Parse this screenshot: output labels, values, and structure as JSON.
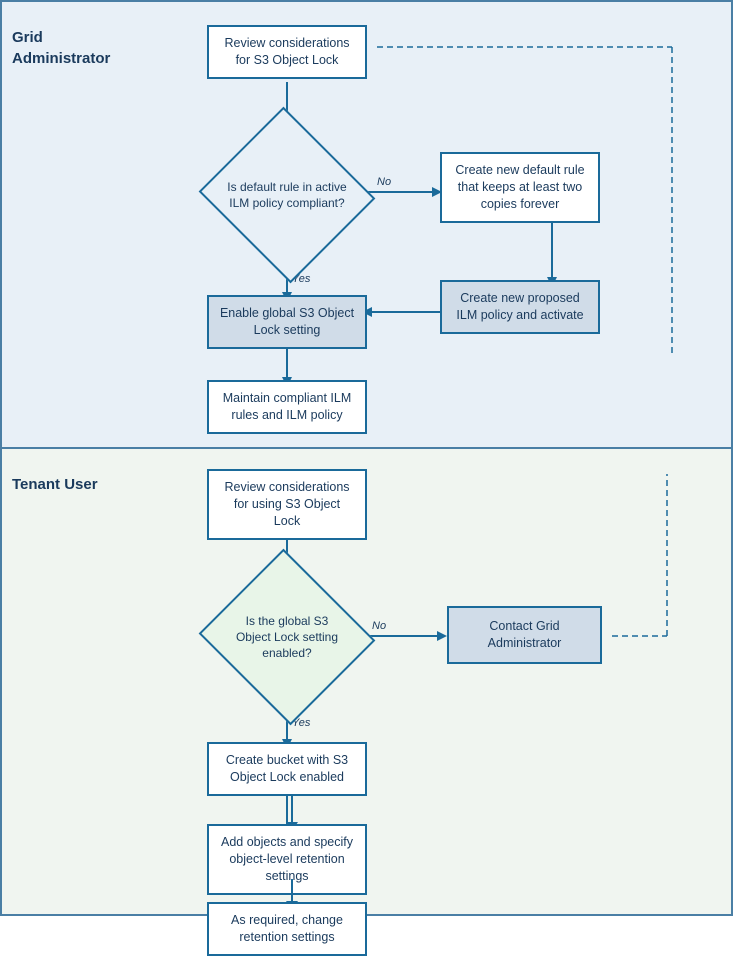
{
  "sections": {
    "top": {
      "label": "Grid\nAdministrator",
      "boxes": {
        "review": "Review considerations for S3 Object Lock",
        "diamond_question": "Is default rule in active ILM policy compliant?",
        "diamond_no_label": "No",
        "diamond_yes_label": "Yes",
        "enable_global": "Enable global S3 Object Lock setting",
        "maintain": "Maintain compliant ILM rules and ILM policy",
        "new_default_rule": "Create new default rule that keeps at least two copies forever",
        "new_proposed_policy": "Create new proposed ILM policy and activate"
      }
    },
    "bottom": {
      "label": "Tenant User",
      "boxes": {
        "review": "Review considerations for using S3 Object Lock",
        "diamond_question": "Is the global S3 Object Lock setting enabled?",
        "diamond_no_label": "No",
        "diamond_yes_label": "Yes",
        "contact_admin": "Contact Grid Administrator",
        "create_bucket": "Create bucket with S3 Object Lock enabled",
        "add_objects": "Add objects and specify object-level retention settings",
        "change_retention": "As required, change retention settings"
      }
    }
  }
}
